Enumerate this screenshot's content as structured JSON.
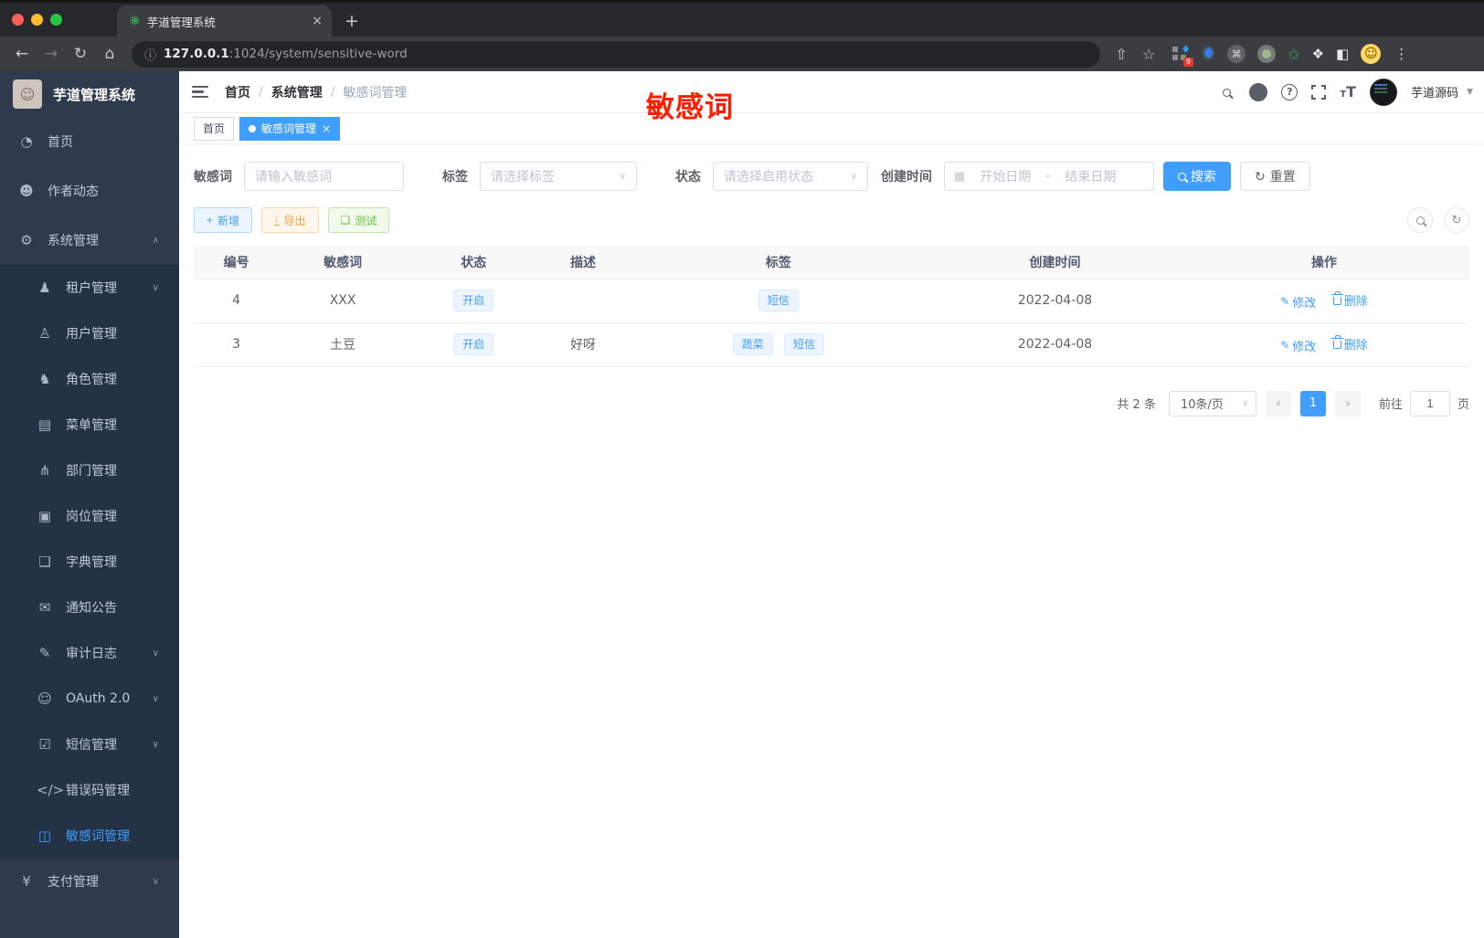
{
  "colors": {
    "accent": "#409eff",
    "sidebar_bg": "#2f3b4d",
    "submenu_bg": "#243245",
    "annotation_red": "#ff1d00",
    "success": "#67c23a",
    "warning": "#e6a23c",
    "tag_blue_bg": "#ecf5ff"
  },
  "browser": {
    "tab_title": "芋道管理系统",
    "url_info_icon": "ⓘ",
    "url_host": "127.0.0.1",
    "url_rest": ":1024/system/sensitive-word",
    "ext_badge": "9"
  },
  "icons": {
    "back": "←",
    "forward": "→",
    "reload": "↻",
    "home": "⌂",
    "share": "⇧",
    "star": "☆",
    "favicon": "❋",
    "close": "×",
    "newtab": "+",
    "gem": "♦",
    "cmd": "⌘",
    "green_star": "✩",
    "puzzle": "❖",
    "panel": "◧",
    "face": "☺",
    "dots": "⋮",
    "help": "?",
    "caret_down": "▼",
    "chevron_up": "∧",
    "chevron_down": "∨",
    "select_caret": "∨",
    "calendar": "▦",
    "plus": "+",
    "download": "↓",
    "doc": "❏",
    "edit": "✎",
    "refresh": "↻",
    "prev": "‹",
    "next": "›",
    "dot": "●",
    "slash": "/",
    "dash": "-",
    "tt_small": "T",
    "tt_big": "T"
  },
  "sidebar": {
    "title": "芋道管理系统",
    "items": [
      {
        "label": "首页",
        "icon": "◔",
        "arrow": ""
      },
      {
        "label": "作者动态",
        "icon": "☻",
        "arrow": ""
      },
      {
        "label": "系统管理",
        "icon": "⚙",
        "arrow": "∧"
      },
      {
        "label": "租户管理",
        "icon": "♟",
        "arrow": "∨"
      },
      {
        "label": "用户管理",
        "icon": "♙",
        "arrow": ""
      },
      {
        "label": "角色管理",
        "icon": "♞",
        "arrow": ""
      },
      {
        "label": "菜单管理",
        "icon": "▤",
        "arrow": ""
      },
      {
        "label": "部门管理",
        "icon": "⋔",
        "arrow": ""
      },
      {
        "label": "岗位管理",
        "icon": "▣",
        "arrow": ""
      },
      {
        "label": "字典管理",
        "icon": "❏",
        "arrow": ""
      },
      {
        "label": "通知公告",
        "icon": "✉",
        "arrow": ""
      },
      {
        "label": "审计日志",
        "icon": "✎",
        "arrow": "∨"
      },
      {
        "label": "OAuth 2.0",
        "icon": "☺",
        "arrow": "∨"
      },
      {
        "label": "短信管理",
        "icon": "☑",
        "arrow": "∨"
      },
      {
        "label": "错误码管理",
        "icon": "</>",
        "arrow": ""
      },
      {
        "label": "敏感词管理",
        "icon": "◫",
        "arrow": ""
      },
      {
        "label": "支付管理",
        "icon": "¥",
        "arrow": "∨"
      }
    ]
  },
  "header": {
    "breadcrumb": [
      "首页",
      "系统管理",
      "敏感词管理"
    ],
    "annotation": "敏感词",
    "username": "芋道源码"
  },
  "tags": {
    "home": "首页",
    "active": "敏感词管理"
  },
  "filters": {
    "keyword_label": "敏感词",
    "keyword_placeholder": "请输入敏感词",
    "tag_label": "标签",
    "tag_placeholder": "请选择标签",
    "status_label": "状态",
    "status_placeholder": "请选择启用状态",
    "date_label": "创建时间",
    "date_start": "开始日期",
    "date_sep": "-",
    "date_end": "结束日期",
    "search_label": "搜索",
    "reset_label": "重置"
  },
  "toolbar": {
    "add_label": "新增",
    "export_label": "导出",
    "test_label": "测试"
  },
  "table": {
    "headers": [
      "编号",
      "敏感词",
      "状态",
      "描述",
      "标签",
      "创建时间",
      "操作"
    ],
    "edit_label": "修改",
    "delete_label": "删除",
    "rows": [
      {
        "id": "4",
        "word": "XXX",
        "status": "开启",
        "desc": "",
        "tag1": "短信",
        "created": "2022-04-08"
      },
      {
        "id": "3",
        "word": "土豆",
        "status": "开启",
        "desc": "好呀",
        "tag1": "蔬菜",
        "tag2": "短信",
        "created": "2022-04-08"
      }
    ]
  },
  "pagination": {
    "total": "共 2 条",
    "page_size": "10条/页",
    "current_page": "1",
    "goto_label": "前往",
    "goto_value": "1",
    "page_unit": "页"
  }
}
